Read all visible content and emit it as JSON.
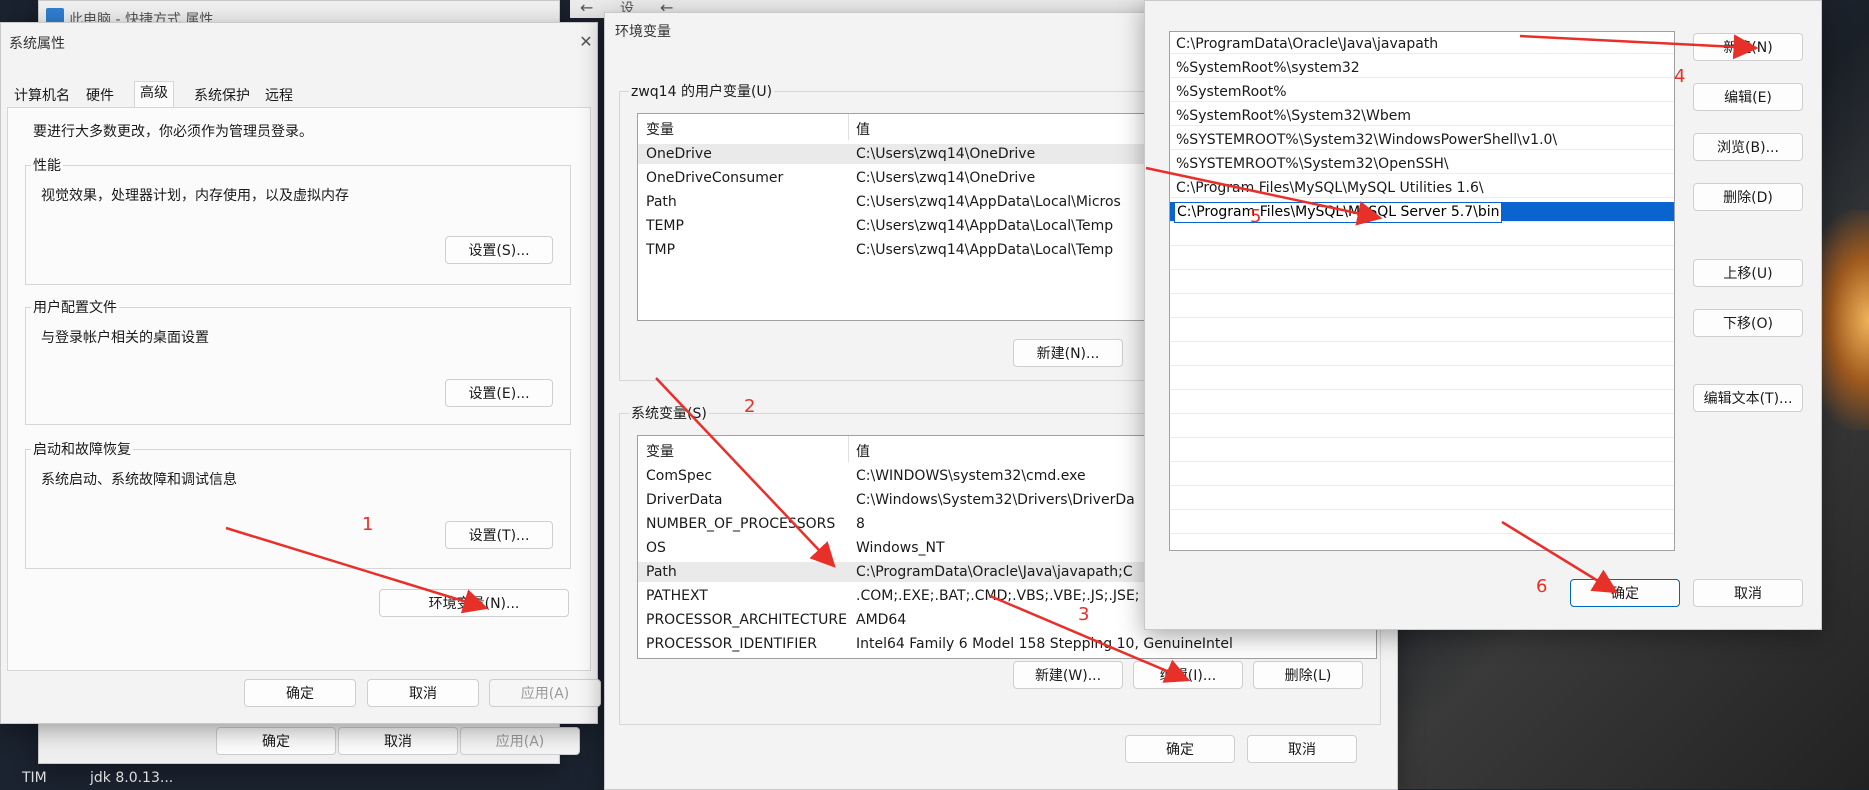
{
  "colors": {
    "accent": "#0067c0",
    "annotation": "#e8302a",
    "selection": "#0a64d0"
  },
  "background_window": {
    "title": "此电脑 - 快捷方式 属性",
    "buttons": {
      "ok": "确定",
      "cancel": "取消",
      "apply": "应用(A)"
    }
  },
  "back_arrow_label": "设",
  "taskbar": {
    "items": [
      "TIM",
      "jdk 8.0.13..."
    ]
  },
  "sysprops": {
    "title": "系统属性",
    "tabs": [
      "计算机名",
      "硬件",
      "高级",
      "系统保护",
      "远程"
    ],
    "admin_note": "要进行大多数更改，你必须作为管理员登录。",
    "performance": {
      "label": "性能",
      "desc": "视觉效果，处理器计划，内存使用，以及虚拟内存",
      "button": "设置(S)..."
    },
    "profiles": {
      "label": "用户配置文件",
      "desc": "与登录帐户相关的桌面设置",
      "button": "设置(E)..."
    },
    "startup": {
      "label": "启动和故障恢复",
      "desc": "系统启动、系统故障和调试信息",
      "button": "设置(T)..."
    },
    "env_button": "环境变量(N)...",
    "buttons": {
      "ok": "确定",
      "cancel": "取消",
      "apply": "应用(A)"
    }
  },
  "envvars": {
    "title": "环境变量",
    "user_label": "zwq14 的用户变量(U)",
    "columns": {
      "var": "变量",
      "val": "值"
    },
    "user_rows": [
      {
        "var": "OneDrive",
        "val": "C:\\Users\\zwq14\\OneDrive"
      },
      {
        "var": "OneDriveConsumer",
        "val": "C:\\Users\\zwq14\\OneDrive"
      },
      {
        "var": "Path",
        "val": "C:\\Users\\zwq14\\AppData\\Local\\Micros"
      },
      {
        "var": "TEMP",
        "val": "C:\\Users\\zwq14\\AppData\\Local\\Temp"
      },
      {
        "var": "TMP",
        "val": "C:\\Users\\zwq14\\AppData\\Local\\Temp"
      }
    ],
    "user_new": "新建(N)...",
    "sys_label": "系统变量(S)",
    "sys_rows": [
      {
        "var": "ComSpec",
        "val": "C:\\WINDOWS\\system32\\cmd.exe"
      },
      {
        "var": "DriverData",
        "val": "C:\\Windows\\System32\\Drivers\\DriverDa"
      },
      {
        "var": "NUMBER_OF_PROCESSORS",
        "val": "8"
      },
      {
        "var": "OS",
        "val": "Windows_NT"
      },
      {
        "var": "Path",
        "val": "C:\\ProgramData\\Oracle\\Java\\javapath;C"
      },
      {
        "var": "PATHEXT",
        "val": ".COM;.EXE;.BAT;.CMD;.VBS;.VBE;.JS;.JSE;"
      },
      {
        "var": "PROCESSOR_ARCHITECTURE",
        "val": "AMD64"
      },
      {
        "var": "PROCESSOR_IDENTIFIER",
        "val": "Intel64 Family 6 Model 158 Stepping 10, GenuineIntel"
      }
    ],
    "sys_buttons": {
      "new": "新建(W)...",
      "edit": "编辑(I)...",
      "delete": "删除(L)"
    },
    "buttons": {
      "ok": "确定",
      "cancel": "取消"
    }
  },
  "editpath": {
    "entries": [
      "C:\\ProgramData\\Oracle\\Java\\javapath",
      "%SystemRoot%\\system32",
      "%SystemRoot%",
      "%SystemRoot%\\System32\\Wbem",
      "%SYSTEMROOT%\\System32\\WindowsPowerShell\\v1.0\\",
      "%SYSTEMROOT%\\System32\\OpenSSH\\",
      "C:\\Program Files\\MySQL\\MySQL Utilities 1.6\\"
    ],
    "editing_value": "C:\\Program Files\\MySQL\\MySQL Server 5.7\\bin",
    "buttons": {
      "new": "新建(N)",
      "edit": "编辑(E)",
      "browse": "浏览(B)...",
      "delete": "删除(D)",
      "up": "上移(U)",
      "down": "下移(O)",
      "edit_text": "编辑文本(T)...",
      "ok": "确定",
      "cancel": "取消"
    }
  },
  "annotations": {
    "n1": "1",
    "n2": "2",
    "n3": "3",
    "n4": "4",
    "n5": "5",
    "n6": "6"
  }
}
